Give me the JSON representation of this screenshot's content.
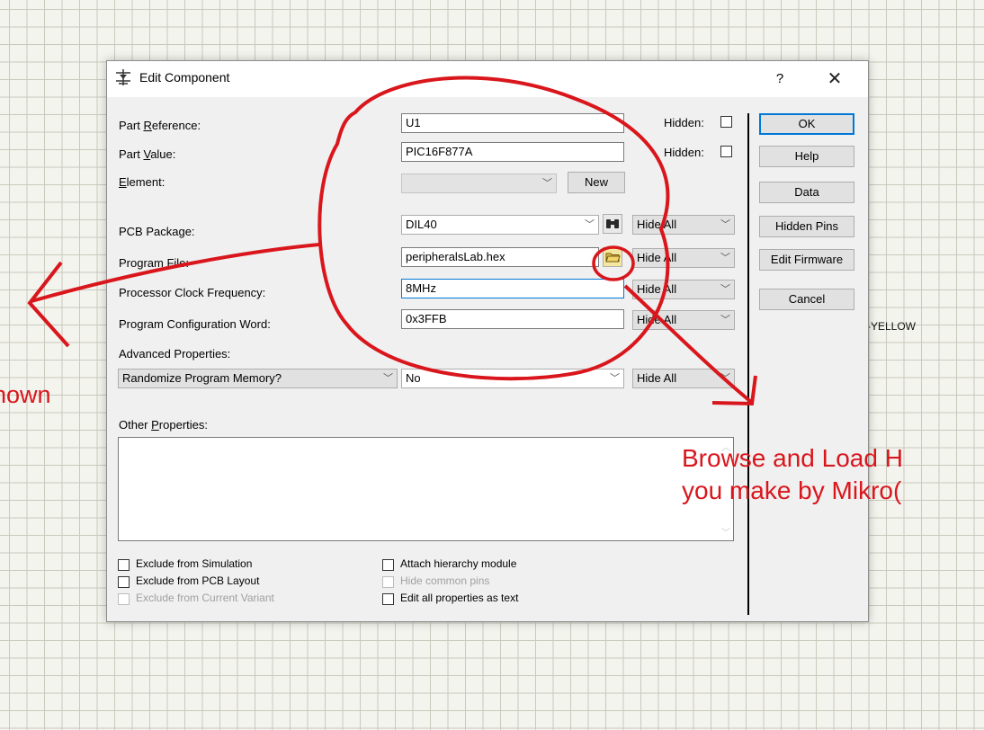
{
  "dialog": {
    "title": "Edit Component",
    "help_glyph": "?",
    "close_glyph": "✕"
  },
  "labels": {
    "part_reference_pre": "Part ",
    "part_reference_ul": "R",
    "part_reference_post": "eference:",
    "part_value_pre": "Part ",
    "part_value_ul": "V",
    "part_value_post": "alue:",
    "element_ul": "E",
    "element_post": "lement:",
    "pcb_package": "PCB Package:",
    "program_file": "Program File:",
    "clock_freq": "Processor Clock Frequency:",
    "config_word": "Program Configuration Word:",
    "advanced": "Advanced Properties:",
    "other_pre": "Other ",
    "other_ul": "P",
    "other_post": "roperties:"
  },
  "fields": {
    "part_reference": "U1",
    "part_value": "PIC16F877A",
    "element": "",
    "pcb_package": "DIL40",
    "program_file": "peripheralsLab.hex",
    "clock_freq": "8MHz",
    "config_word": "0x3FFB",
    "advanced_property": "Randomize Program Memory?",
    "advanced_value": "No"
  },
  "visibility": {
    "hidden_label": "Hidden:",
    "pcb": "Hide All",
    "program_file": "Hide All",
    "clock": "Hide All",
    "config": "Hide All",
    "advanced": "Hide All"
  },
  "buttons": {
    "new": "New",
    "ok": "OK",
    "help": "Help",
    "data": "Data",
    "hidden_pins": "Hidden Pins",
    "edit_firmware": "Edit Firmware",
    "cancel": "Cancel"
  },
  "checkboxes": {
    "exclude_simulation": "Exclude from Simulation",
    "exclude_pcb": "Exclude from PCB Layout",
    "exclude_variant": "Exclude from Current Variant",
    "attach_hierarchy": "Attach hierarchy module",
    "hide_common_pins": "Hide common pins",
    "edit_as_text": "Edit all properties as text"
  },
  "canvas": {
    "yellow_label": "-YELLOW"
  },
  "annotations": {
    "left_text": "hown",
    "right_line1": "Browse and Load H",
    "right_line2": "you make by Mikro("
  },
  "colors": {
    "annotation_red": "#d9161c",
    "focus_blue": "#0078d7"
  }
}
